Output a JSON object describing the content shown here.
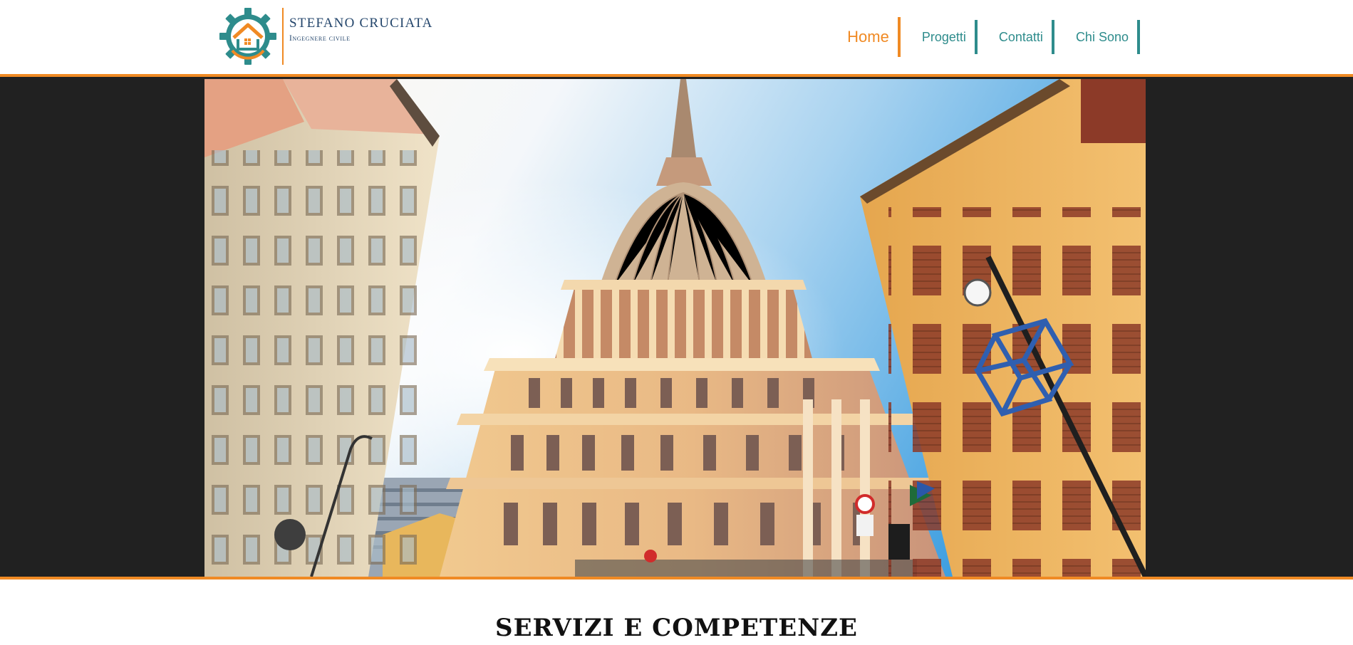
{
  "brand": {
    "name": "STEFANO  CRUCIATA",
    "subtitle": "Ingegnere civile",
    "logo_icon": "gear-house-logo"
  },
  "nav": {
    "items": [
      {
        "label": "Home",
        "active": true
      },
      {
        "label": "Progetti",
        "active": false
      },
      {
        "label": "Contatti",
        "active": false
      },
      {
        "label": "Chi Sono",
        "active": false
      }
    ]
  },
  "hero": {
    "image": "photo-mole-antonelliana-turin"
  },
  "section": {
    "title": "SERVIZI E COMPETENZE"
  },
  "colors": {
    "accent": "#f08a24",
    "teal": "#2e8c8c",
    "navy": "#23456b",
    "hero_bg": "#212121"
  }
}
